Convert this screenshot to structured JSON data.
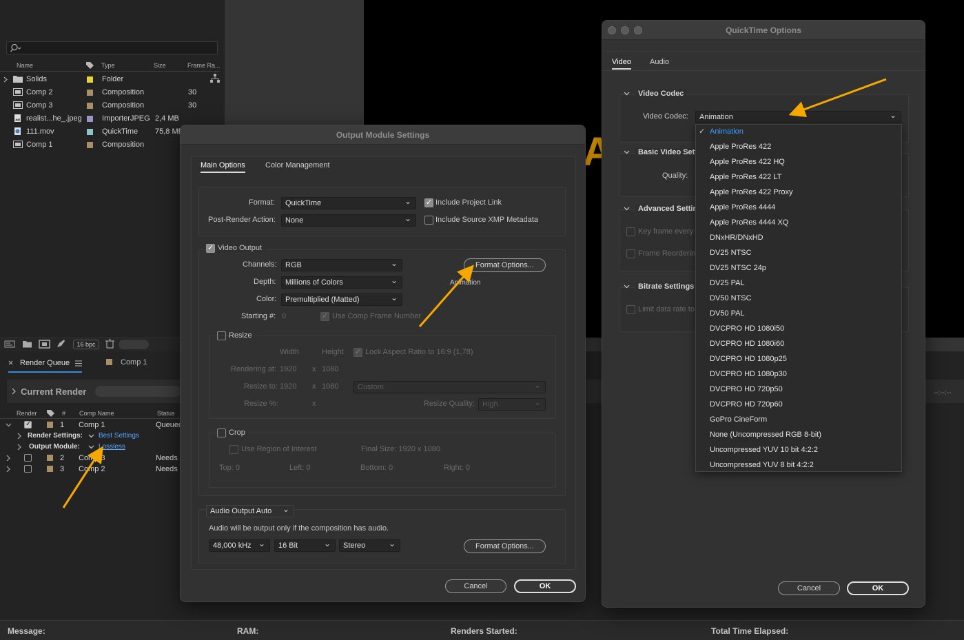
{
  "colors": {
    "accent": "#2d8ceb",
    "link": "#58a6ff",
    "annotation_arrow": "#f5a800",
    "selected_item": "#3b9dff"
  },
  "project": {
    "search_placeholder": "",
    "columns": {
      "name": "Name",
      "type": "Type",
      "size": "Size",
      "frame_rate": "Frame Ra..."
    },
    "items": [
      {
        "name": "Solids",
        "type": "Folder",
        "size": "",
        "fps": "",
        "icon": "folder-icon",
        "label_color": "#e8d23a"
      },
      {
        "name": "Comp 2",
        "type": "Composition",
        "size": "",
        "fps": "30",
        "icon": "composition-icon",
        "label_color": "#a88f6a"
      },
      {
        "name": "Comp 3",
        "type": "Composition",
        "size": "",
        "fps": "30",
        "icon": "composition-icon",
        "label_color": "#a88f6a"
      },
      {
        "name": "realist...he_.jpeg",
        "type": "ImporterJPEG",
        "size": "2,4 MB",
        "fps": "",
        "icon": "image-file-icon",
        "label_color": "#9a93c4"
      },
      {
        "name": "111.mov",
        "type": "QuickTime",
        "size": "75,8 MB",
        "fps": "",
        "icon": "movie-file-icon",
        "label_color": "#8fc5c5"
      },
      {
        "name": "Comp 1",
        "type": "Composition",
        "size": "",
        "fps": "",
        "icon": "composition-icon",
        "label_color": "#a88f6a"
      }
    ],
    "bpc": "16 bpc"
  },
  "viewer": {
    "partial_glyph": "A"
  },
  "render_queue": {
    "tab_label": "Render Queue",
    "comp_tab": "Comp 1",
    "current_render": "Current Render",
    "time_readout": "--:--:--",
    "columns": {
      "render": "Render",
      "num": "#",
      "comp_name": "Comp Name",
      "status": "Status"
    },
    "rows": [
      {
        "num": "1",
        "comp": "Comp 1",
        "status": "Queued",
        "checked": true
      },
      {
        "num": "2",
        "comp": "Comp 3",
        "status": "Needs O",
        "checked": false
      },
      {
        "num": "3",
        "comp": "Comp 2",
        "status": "Needs O",
        "checked": false
      }
    ],
    "render_settings_label": "Render Settings:",
    "render_settings_value": "Best Settings",
    "output_module_label": "Output Module:",
    "output_module_value": "Lossless"
  },
  "status_bar": {
    "message": "Message:",
    "ram": "RAM:",
    "renders_started": "Renders Started:",
    "total_time": "Total Time Elapsed:"
  },
  "output_module": {
    "title": "Output Module Settings",
    "tabs": [
      "Main Options",
      "Color Management"
    ],
    "format_label": "Format:",
    "format_value": "QuickTime",
    "post_render_label": "Post-Render Action:",
    "post_render_value": "None",
    "include_project_link": "Include Project Link",
    "include_xmp": "Include Source XMP Metadata",
    "video_output": "Video Output",
    "channels_label": "Channels:",
    "channels_value": "RGB",
    "depth_label": "Depth:",
    "depth_value": "Millions of Colors",
    "color_label": "Color:",
    "color_value": "Premultiplied (Matted)",
    "starting_label": "Starting #:",
    "starting_value": "0",
    "use_comp_frame": "Use Comp Frame Number",
    "format_options": "Format Options...",
    "codec_caption": "Animation",
    "resize": "Resize",
    "width_hdr": "Width",
    "height_hdr": "Height",
    "lock_aspect": "Lock Aspect Ratio to 16:9 (1,78)",
    "rendering_at": "Rendering at:",
    "rendering_w": "1920",
    "rendering_h": "1080",
    "resize_to": "Resize to:",
    "resize_w": "1920",
    "resize_h": "1080",
    "resize_preset": "Custom",
    "resize_pct": "Resize %:",
    "x": "x",
    "resize_quality_label": "Resize Quality:",
    "resize_quality_value": "High",
    "crop": "Crop",
    "use_roi": "Use Region of Interest",
    "final_size": "Final Size: 1920 x 1080",
    "top": "Top:  0",
    "left": "Left:  0",
    "bottom": "Bottom:  0",
    "right": "Right:  0",
    "audio_output": "Audio Output Auto",
    "audio_note": "Audio will be output only if the composition has audio.",
    "sample_rate": "48,000 kHz",
    "bit_depth": "16 Bit",
    "channels_audio": "Stereo",
    "audio_format_options": "Format Options...",
    "cancel": "Cancel",
    "ok": "OK"
  },
  "quicktime": {
    "title": "QuickTime Options",
    "tabs": [
      "Video",
      "Audio"
    ],
    "video_codec_section": "Video Codec",
    "video_codec_label": "Video Codec:",
    "video_codec_value": "Animation",
    "basic_video_settings": "Basic Video Setti",
    "quality_label": "Quality:",
    "advanced_settings": "Advanced Setting",
    "key_frame": "Key frame every",
    "frame_reordering": "Frame Reordering",
    "bitrate_settings": "Bitrate Settings",
    "limit_rate": "Limit data rate to",
    "cancel": "Cancel",
    "ok": "OK",
    "codec_options": [
      "Animation",
      "Apple ProRes 422",
      "Apple ProRes 422 HQ",
      "Apple ProRes 422 LT",
      "Apple ProRes 422 Proxy",
      "Apple ProRes 4444",
      "Apple ProRes 4444 XQ",
      "DNxHR/DNxHD",
      "DV25 NTSC",
      "DV25 NTSC 24p",
      "DV25 PAL",
      "DV50 NTSC",
      "DV50 PAL",
      "DVCPRO HD 1080i50",
      "DVCPRO HD 1080i60",
      "DVCPRO HD 1080p25",
      "DVCPRO HD 1080p30",
      "DVCPRO HD 720p50",
      "DVCPRO HD 720p60",
      "GoPro CineForm",
      "None (Uncompressed RGB 8-bit)",
      "Uncompressed YUV 10 bit 4:2:2",
      "Uncompressed YUV 8 bit 4:2:2"
    ]
  }
}
